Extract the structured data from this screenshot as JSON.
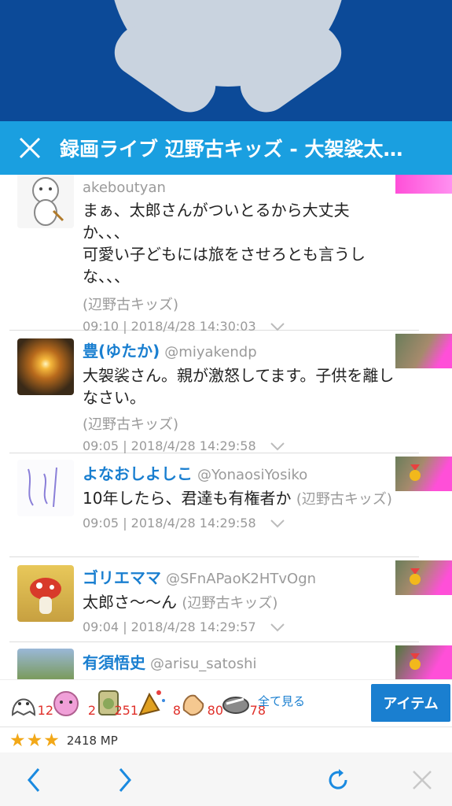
{
  "header": {
    "title": "録画ライブ 辺野古キッズ - 大袈裟太…"
  },
  "comments": [
    {
      "name": "",
      "handle": "akeboutyan",
      "text": "まぁ、太郎さんがついとるから大丈夫か、、、\n可愛い子どもには旅をさせろとも言うしな、、、",
      "source": "(辺野古キッズ)",
      "time": "09:10 | 2018/4/28 14:30:03"
    },
    {
      "name": "豊(ゆたか)",
      "handle": "@miyakendp",
      "text": "大袈裟さん。親が激怒してます。子供を離しなさい。",
      "source": "(辺野古キッズ)",
      "time": "09:05 | 2018/4/28 14:29:58"
    },
    {
      "name": "よなおしよしこ",
      "handle": "@YonaosiYosiko",
      "text": "10年したら、君達も有権者か",
      "source": "(辺野古キッズ)",
      "time": "09:05 | 2018/4/28 14:29:58"
    },
    {
      "name": "ゴリエママ",
      "handle": "@SFnAPaoK2HTvOgn",
      "text": "太郎さ〜〜ん",
      "source": "(辺野古キッズ)",
      "time": "09:04 | 2018/4/28 14:29:57"
    },
    {
      "name": "有須悟史",
      "handle": "@arisu_satoshi",
      "text": "",
      "source": "",
      "time": ""
    }
  ],
  "items": {
    "counts": [
      "12",
      "2",
      "251",
      "8",
      "80",
      "78"
    ],
    "see_all": "全て見る",
    "button": "アイテム"
  },
  "rating": {
    "stars": "★★★",
    "mp": "2418 MP",
    "star_color": "#f2a818"
  },
  "colors": {
    "accent": "#1a9fe0",
    "link": "#1a7fd0",
    "hero": "#0c4a98"
  }
}
